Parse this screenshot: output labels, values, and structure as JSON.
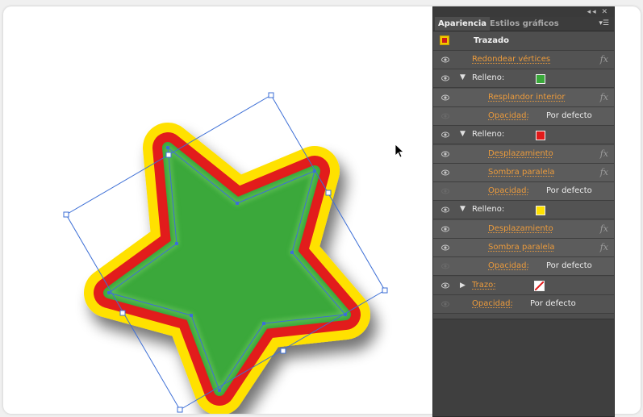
{
  "panel": {
    "tabs": [
      "Apariencia",
      "Estilos gráficos"
    ],
    "window_controls": "◂◂ ✕",
    "menu_icon": "panel-menu-icon",
    "object_title": "Trazado",
    "rows": [
      {
        "label": "Redondear vértices",
        "fx": "fx"
      },
      {
        "label": "Relleno:",
        "swatch": "#3aa83a"
      },
      {
        "label": "Resplandor interior",
        "fx": "fx"
      },
      {
        "label": "Opacidad:",
        "value": "Por defecto"
      },
      {
        "label": "Relleno:",
        "swatch": "#e21a1a"
      },
      {
        "label": "Desplazamiento",
        "fx": "fx"
      },
      {
        "label": "Sombra paralela",
        "fx": "fx"
      },
      {
        "label": "Opacidad:",
        "value": "Por defecto"
      },
      {
        "label": "Relleno:",
        "swatch": "#ffe100"
      },
      {
        "label": "Desplazamiento",
        "fx": "fx"
      },
      {
        "label": "Sombra paralela",
        "fx": "fx"
      },
      {
        "label": "Opacidad:",
        "value": "Por defecto"
      },
      {
        "label": "Trazo:",
        "swatch": "none"
      },
      {
        "label": "Opacidad:",
        "value": "Por defecto"
      }
    ]
  },
  "colors": {
    "accent_orange": "#ec9b3c",
    "star_green": "#3aa83a",
    "star_red": "#e21a1a",
    "star_yellow": "#ffe100",
    "selection_blue": "#3d6fd6"
  }
}
